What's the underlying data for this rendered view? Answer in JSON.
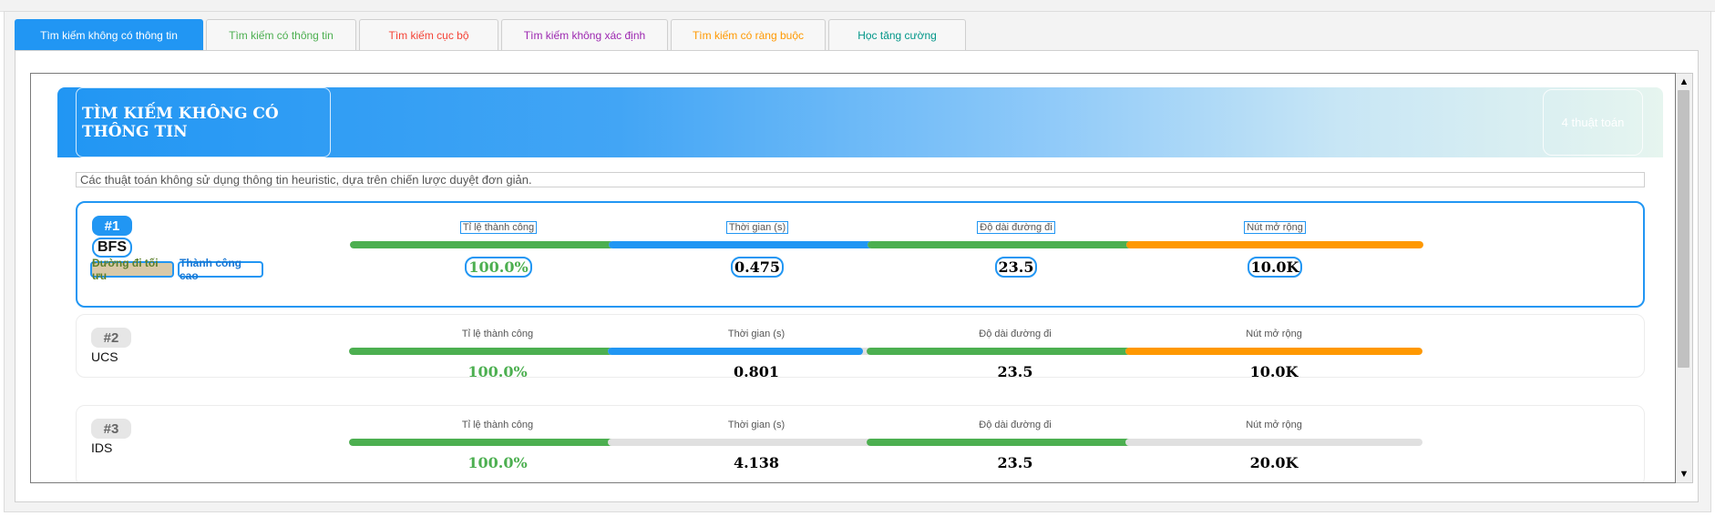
{
  "tabs": [
    {
      "label": "Tìm kiếm không có thông tin",
      "color": "#ffffff",
      "active": true
    },
    {
      "label": "Tìm kiếm có thông tin",
      "color": "#4caf50"
    },
    {
      "label": "Tìm kiếm cục bộ",
      "color": "#f44336"
    },
    {
      "label": "Tìm kiếm không xác định",
      "color": "#9c27b0"
    },
    {
      "label": "Tìm kiếm có ràng buộc",
      "color": "#ff9800"
    },
    {
      "label": "Học tăng cường",
      "color": "#009688"
    }
  ],
  "header": {
    "title": "TÌM KIẾM KHÔNG CÓ THÔNG TIN",
    "count": "4 thuật toán"
  },
  "description": "Các thuật toán không sử dụng thông tin heuristic, dựa trên chiến lược duyệt đơn giản.",
  "metric_labels": [
    "Tỉ lệ thành công",
    "Thời gian (s)",
    "Độ dài đường đi",
    "Nút mở rộng"
  ],
  "colors": {
    "green": "#4caf50",
    "blue": "#2196f3",
    "orange": "#ff9800",
    "gray": "#e0e0e0"
  },
  "algorithms": [
    {
      "rank": "#1",
      "name": "BFS",
      "badges": [
        "Đường đi tối ưu",
        "Thành công cao"
      ],
      "metrics": [
        {
          "value": "100.0%",
          "fill": 1.0,
          "color": "#4caf50"
        },
        {
          "value": "0.475",
          "fill": 0.95,
          "color": "#2196f3"
        },
        {
          "value": "23.5",
          "fill": 1.0,
          "color": "#4caf50"
        },
        {
          "value": "10.0K",
          "fill": 1.0,
          "color": "#ff9800"
        }
      ]
    },
    {
      "rank": "#2",
      "name": "UCS",
      "metrics": [
        {
          "value": "100.0%",
          "fill": 1.0,
          "color": "#4caf50"
        },
        {
          "value": "0.801",
          "fill": 0.86,
          "color": "#2196f3"
        },
        {
          "value": "23.5",
          "fill": 1.0,
          "color": "#4caf50"
        },
        {
          "value": "10.0K",
          "fill": 1.0,
          "color": "#ff9800"
        }
      ]
    },
    {
      "rank": "#3",
      "name": "IDS",
      "metrics": [
        {
          "value": "100.0%",
          "fill": 1.0,
          "color": "#4caf50"
        },
        {
          "value": "4.138",
          "fill": 0.0,
          "color": "#2196f3"
        },
        {
          "value": "23.5",
          "fill": 1.0,
          "color": "#4caf50"
        },
        {
          "value": "20.0K",
          "fill": 0.0,
          "color": "#ff9800"
        }
      ]
    }
  ]
}
